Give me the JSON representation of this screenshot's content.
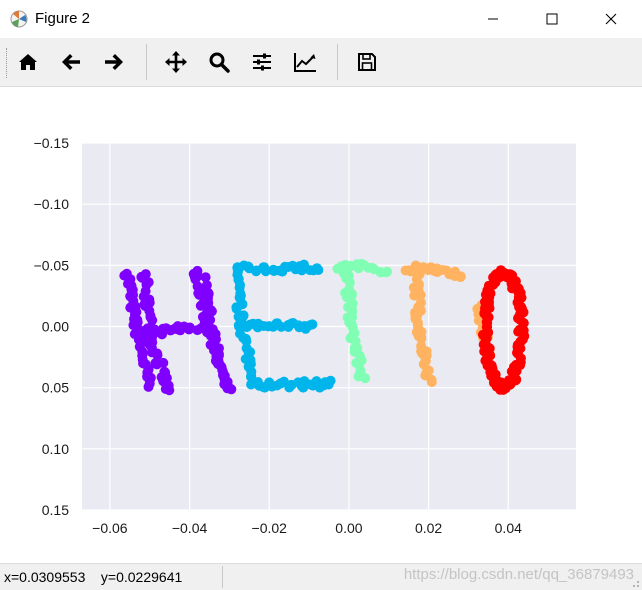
{
  "window": {
    "title": "Figure 2"
  },
  "toolbar": {
    "buttons": [
      {
        "name": "home-icon"
      },
      {
        "name": "back-arrow-icon"
      },
      {
        "name": "forward-arrow-icon"
      },
      {
        "name": "pan-icon"
      },
      {
        "name": "zoom-icon"
      },
      {
        "name": "subplots-icon"
      },
      {
        "name": "edit-axes-icon"
      },
      {
        "name": "save-icon"
      }
    ]
  },
  "status": {
    "coords": "x=0.0309553    y=0.0229641",
    "watermark": "https://blog.csdn.net/qq_36879493"
  },
  "colors": {
    "axes_bg": "#eaeaf2",
    "grid": "#ffffff",
    "H": "#8000ff",
    "E": "#00b5eb",
    "L": "#80ffb4",
    "L2": "#ffb360",
    "O": "#ff0000"
  },
  "chart_data": {
    "type": "scatter",
    "xlim": [
      -0.067,
      0.057
    ],
    "ylim": [
      0.15,
      -0.15
    ],
    "y_inverted": true,
    "grid": true,
    "xticks": [
      "−0.06",
      "−0.04",
      "−0.02",
      "0.00",
      "0.02",
      "0.04"
    ],
    "yticks": [
      "−0.15",
      "−0.10",
      "−0.05",
      "0.00",
      "0.05",
      "0.10",
      "0.15"
    ],
    "xtick_values": [
      -0.06,
      -0.04,
      -0.02,
      0.0,
      0.02,
      0.04
    ],
    "ytick_values": [
      -0.15,
      -0.1,
      -0.05,
      0.0,
      0.05,
      0.1,
      0.15
    ],
    "series": [
      {
        "color": "#8000ff",
        "strokes": [
          [
            [
              -0.0555,
              -0.044
            ],
            [
              -0.0535,
              0.0
            ],
            [
              -0.051,
              0.035
            ],
            [
              -0.05,
              0.05
            ]
          ],
          [
            [
              -0.0515,
              -0.045
            ],
            [
              -0.0495,
              0.012
            ],
            [
              -0.047,
              0.035
            ],
            [
              -0.0455,
              0.053
            ]
          ],
          [
            [
              -0.053,
              0.006
            ],
            [
              -0.045,
              0.003
            ],
            [
              -0.037,
              0.0
            ]
          ],
          [
            [
              -0.0385,
              -0.046
            ],
            [
              -0.035,
              0.005
            ],
            [
              -0.031,
              0.045
            ],
            [
              -0.03,
              0.052
            ]
          ],
          [
            [
              -0.0365,
              -0.038
            ],
            [
              -0.034,
              0.01
            ],
            [
              -0.032,
              0.035
            ]
          ]
        ]
      },
      {
        "color": "#00b5eb",
        "strokes": [
          [
            [
              -0.0285,
              -0.047
            ],
            [
              -0.027,
              0.0
            ],
            [
              -0.0235,
              0.048
            ]
          ],
          [
            [
              -0.0285,
              -0.047
            ],
            [
              -0.0075,
              -0.048
            ]
          ],
          [
            [
              -0.0265,
              -0.001
            ],
            [
              -0.0085,
              0.0
            ]
          ],
          [
            [
              -0.0235,
              0.048
            ],
            [
              -0.0045,
              0.047
            ]
          ]
        ]
      },
      {
        "color": "#80ffb4",
        "strokes": [
          [
            [
              -0.0035,
              -0.048
            ],
            [
              0.0035,
              -0.05
            ],
            [
              0.0095,
              -0.045
            ]
          ],
          [
            [
              -0.0005,
              -0.048
            ],
            [
              0.0005,
              0.0
            ],
            [
              0.0035,
              0.045
            ]
          ]
        ]
      },
      {
        "color": "#ffb360",
        "strokes": [
          [
            [
              0.0135,
              -0.047
            ],
            [
              0.021,
              -0.047
            ],
            [
              0.0285,
              -0.043
            ]
          ],
          [
            [
              0.017,
              -0.046
            ],
            [
              0.0175,
              0.0
            ],
            [
              0.0205,
              0.045
            ]
          ],
          [
            [
              0.0325,
              -0.015
            ],
            [
              0.035,
              0.02
            ]
          ]
        ]
      },
      {
        "color": "#ff0000",
        "ellipse": {
          "cx": 0.0388,
          "cy": 0.003,
          "rx": 0.0045,
          "ry": 0.047
        }
      }
    ]
  }
}
